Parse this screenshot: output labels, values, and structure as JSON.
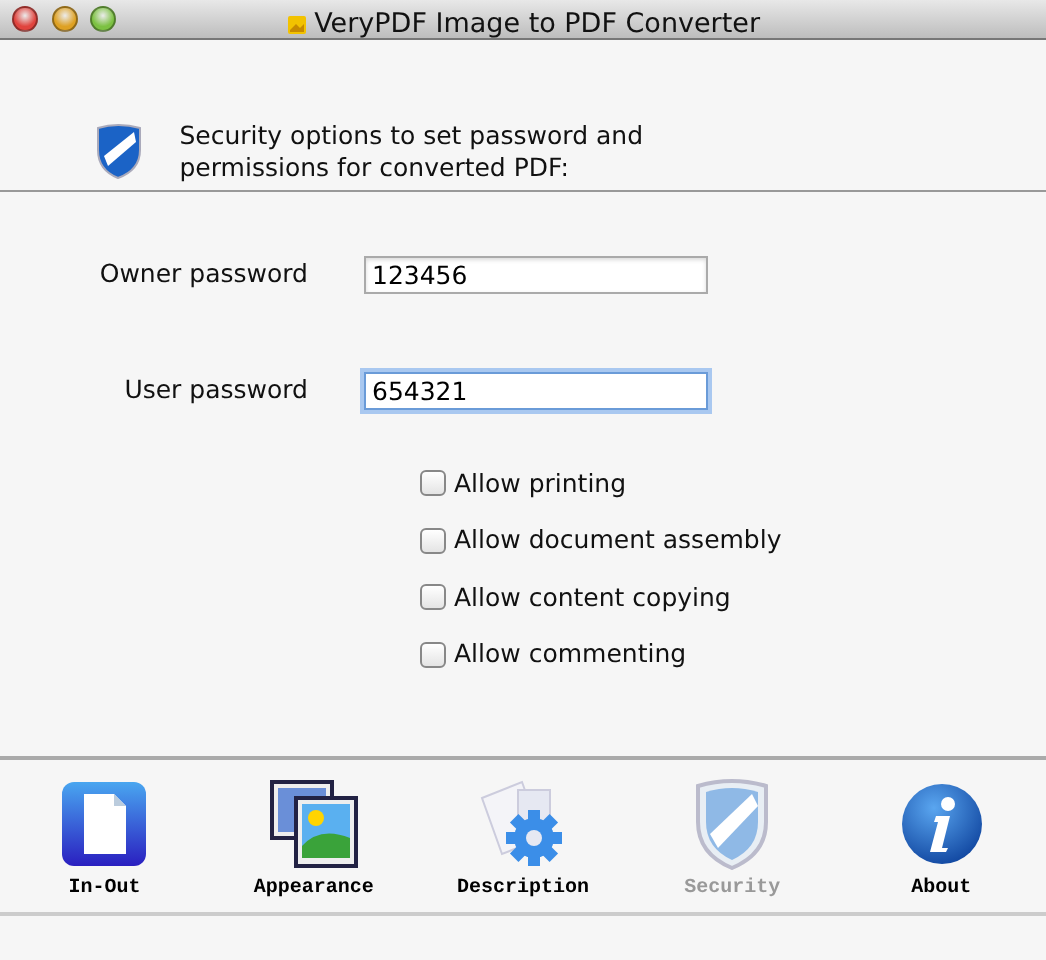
{
  "window": {
    "title": "VeryPDF Image to PDF Converter"
  },
  "header": {
    "text": "Security options to set password and permissions for converted PDF:"
  },
  "fields": [
    {
      "label": "Owner password",
      "value": "123456",
      "focused": false
    },
    {
      "label": "User password",
      "value": "654321",
      "focused": true
    }
  ],
  "permissions": [
    {
      "label": "Allow printing",
      "checked": false
    },
    {
      "label": "Allow document assembly",
      "checked": false
    },
    {
      "label": "Allow content copying",
      "checked": false
    },
    {
      "label": "Allow commenting",
      "checked": false
    }
  ],
  "toolbar": [
    {
      "label": "In-Out",
      "kind": "document",
      "selected": false
    },
    {
      "label": "Appearance",
      "kind": "pictures",
      "selected": false
    },
    {
      "label": "Description",
      "kind": "gear",
      "selected": false
    },
    {
      "label": "Security",
      "kind": "shield",
      "selected": true
    },
    {
      "label": "About",
      "kind": "info",
      "selected": false
    }
  ]
}
